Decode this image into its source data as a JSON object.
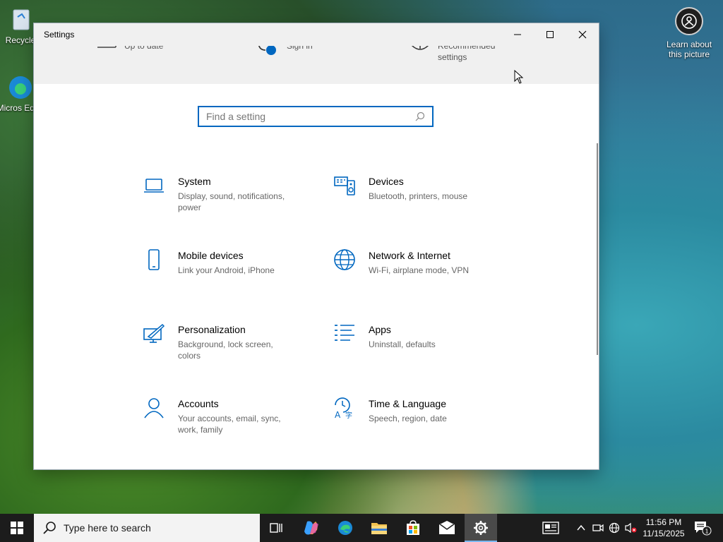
{
  "desktop": {
    "icons": [
      {
        "label": "Recycle"
      },
      {
        "label": "Micros Edge"
      }
    ],
    "learn": {
      "label": "Learn about this picture"
    }
  },
  "window": {
    "title": "Settings",
    "banner": {
      "item1_text": "Up to date",
      "item2_text": "Sign in",
      "item3_text": "Recommended settings"
    },
    "search": {
      "placeholder": "Find a setting"
    },
    "categories": [
      {
        "name": "System",
        "desc": "Display, sound, notifications, power",
        "icon": "laptop-icon"
      },
      {
        "name": "Devices",
        "desc": "Bluetooth, printers, mouse",
        "icon": "devices-icon"
      },
      {
        "name": "Mobile devices",
        "desc": "Link your Android, iPhone",
        "icon": "phone-icon"
      },
      {
        "name": "Network & Internet",
        "desc": "Wi-Fi, airplane mode, VPN",
        "icon": "globe-icon"
      },
      {
        "name": "Personalization",
        "desc": "Background, lock screen, colors",
        "icon": "paint-icon"
      },
      {
        "name": "Apps",
        "desc": "Uninstall, defaults",
        "icon": "apps-list-icon"
      },
      {
        "name": "Accounts",
        "desc": "Your accounts, email, sync, work, family",
        "icon": "person-icon"
      },
      {
        "name": "Time & Language",
        "desc": "Speech, region, date",
        "icon": "time-language-icon"
      }
    ]
  },
  "taskbar": {
    "search_placeholder": "Type here to search",
    "time": "11:56 PM",
    "date": "11/15/2025",
    "notification_count": "1"
  },
  "colors": {
    "accent": "#0067c0",
    "taskbar": "#1c1c1c"
  }
}
